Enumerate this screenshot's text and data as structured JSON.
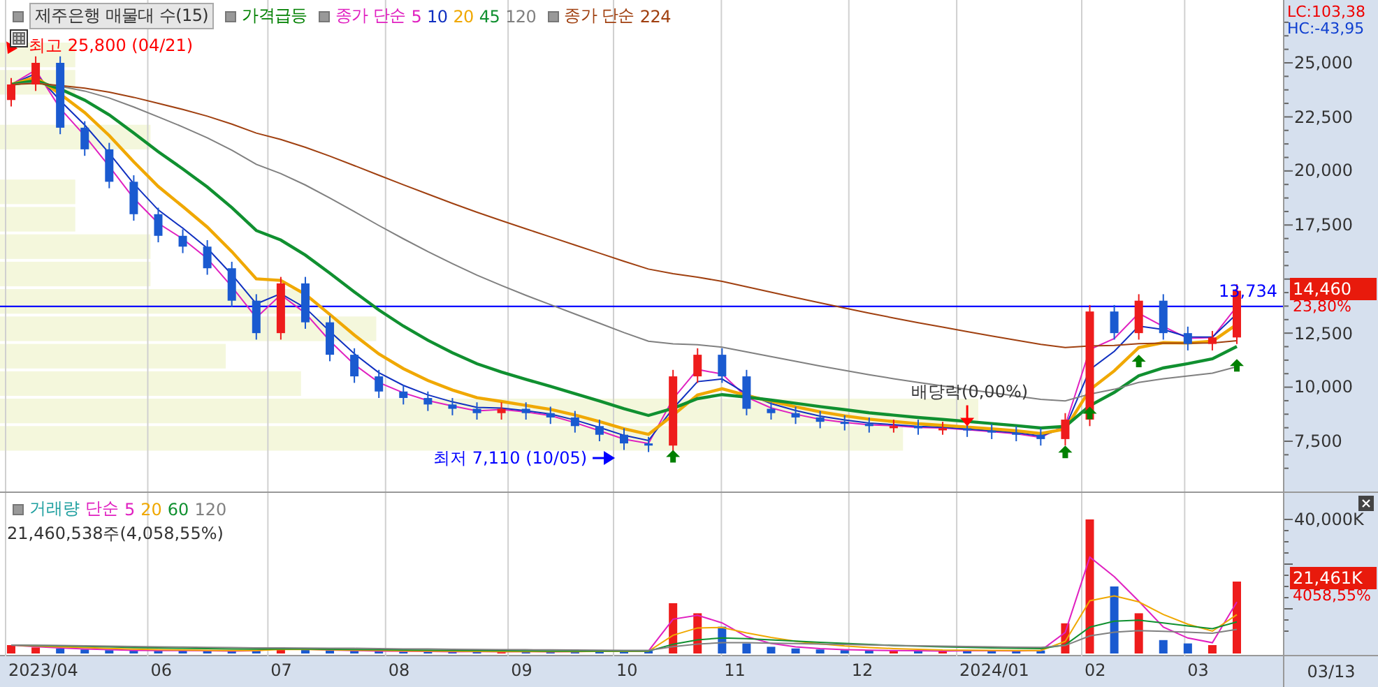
{
  "price_chart": {
    "legend": [
      {
        "kind": "title",
        "label": "제주은행 매물대 수(15)"
      },
      {
        "kind": "signal",
        "label": "가격급등",
        "color": "#008000"
      },
      {
        "kind": "ma",
        "label": "종가 단순",
        "color": "#e020c0",
        "periods": [
          {
            "label": "5",
            "color": "#e020c0"
          },
          {
            "label": "10",
            "color": "#1030c0"
          },
          {
            "label": "20",
            "color": "#f0a800"
          },
          {
            "label": "45",
            "color": "#109030"
          },
          {
            "label": "120",
            "color": "#808080"
          }
        ]
      },
      {
        "kind": "ma",
        "label": "종가 단순",
        "color": "#a04010",
        "periods": [
          {
            "label": "224",
            "color": "#a04010"
          }
        ]
      }
    ],
    "lc": "LC:103,38",
    "hc": "HC:-43,95",
    "axis_labels": [
      "25,000",
      "22,500",
      "20,000",
      "17,500",
      "12,500",
      "10,000",
      "7,500"
    ],
    "high_label": "최고 25,800 (04/21)",
    "low_label": "최저 7,110 (10/05)",
    "event_label": "배당락(0,00%)",
    "reference_label": "13,734",
    "last_price": {
      "label": "14,460",
      "change": "23,80%"
    }
  },
  "volume_chart": {
    "legend": [
      {
        "kind": "title",
        "label": "거래량",
        "color": "#20a0a0"
      },
      {
        "kind": "ma",
        "label": "단순",
        "color": "#e020c0",
        "periods": [
          {
            "label": "5",
            "color": "#e020c0"
          },
          {
            "label": "20",
            "color": "#f0a800"
          },
          {
            "label": "60",
            "color": "#109030"
          },
          {
            "label": "120",
            "color": "#808080"
          }
        ]
      }
    ],
    "summary": "21,460,538주(4,058,55%)",
    "axis_label": "40,000K",
    "last_volume": {
      "label": "21,461K",
      "change": "4058,55%"
    }
  },
  "date_labels": [
    "2023/04",
    "06",
    "07",
    "08",
    "09",
    "10",
    "11",
    "12",
    "2024/01",
    "02",
    "03"
  ],
  "last_date": "03/13"
}
